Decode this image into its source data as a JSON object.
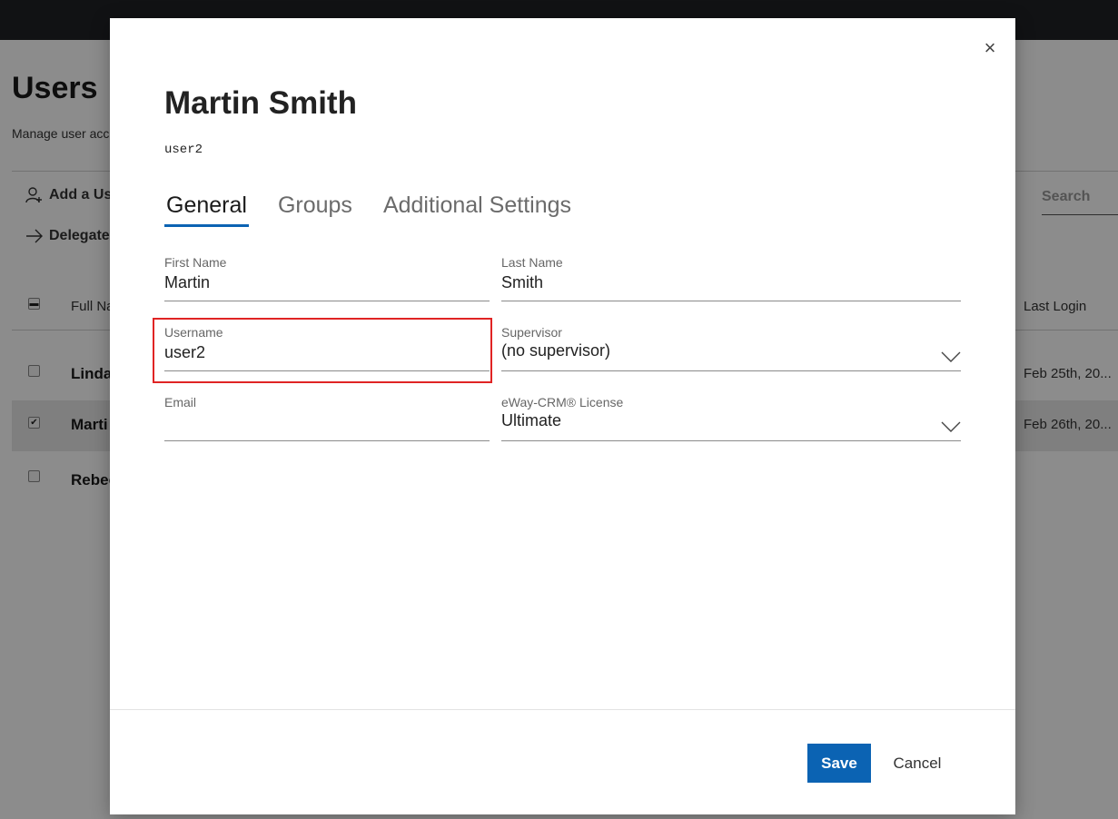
{
  "background": {
    "page_title": "Users",
    "description": "Manage user acco",
    "actions": [
      {
        "label": "Add a Us",
        "icon": "add-user-icon"
      },
      {
        "label": "Delegate",
        "icon": "arrow-right-icon"
      }
    ],
    "search": {
      "placeholder": "Search",
      "value": ""
    },
    "columns": {
      "full_name": "Full Na",
      "last_login": "Last Login"
    },
    "rows": [
      {
        "name": "Linda",
        "last_login": "Feb 25th, 20...",
        "checked": false,
        "selected": false
      },
      {
        "name": "Marti",
        "last_login": "Feb 26th, 20...",
        "checked": true,
        "selected": true
      },
      {
        "name": "Rebec",
        "last_login": "",
        "checked": false,
        "selected": false
      }
    ]
  },
  "modal": {
    "title": "Martin Smith",
    "subtitle": "user2",
    "close_icon": "close-icon",
    "tabs": [
      {
        "label": "General",
        "active": true
      },
      {
        "label": "Groups",
        "active": false
      },
      {
        "label": "Additional Settings",
        "active": false
      }
    ],
    "fields": {
      "first_name": {
        "label": "First Name",
        "value": "Martin"
      },
      "last_name": {
        "label": "Last Name",
        "value": "Smith"
      },
      "username": {
        "label": "Username",
        "value": "user2"
      },
      "supervisor": {
        "label": "Supervisor",
        "value": "(no supervisor)"
      },
      "email": {
        "label": "Email",
        "value": ""
      },
      "license": {
        "label": "eWay-CRM® License",
        "value": "Ultimate"
      }
    },
    "buttons": {
      "save": "Save",
      "cancel": "Cancel"
    }
  },
  "colors": {
    "accent": "#0b63b3",
    "highlight": "#e02424",
    "topbar": "#1f2225"
  }
}
